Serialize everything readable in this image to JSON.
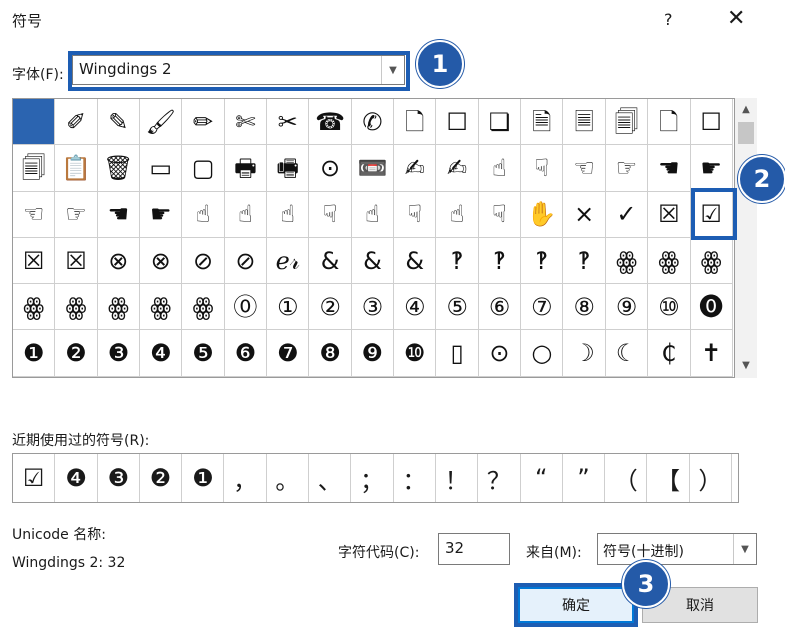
{
  "dialog": {
    "title": "符号",
    "help_label": "?",
    "close_label": "✕"
  },
  "font": {
    "label": "字体(F):",
    "value": "Wingdings 2"
  },
  "symbols": [
    "",
    "✐",
    "✎",
    "🖌",
    "✏",
    "✄",
    "✂",
    "☎",
    "✆",
    "🗋",
    "☐",
    "❏",
    "🗎",
    "🗏",
    "🗐",
    "🗋",
    "☐",
    "🗐",
    "📋",
    "🗑",
    "▭",
    "▢",
    "🖶",
    "🖷",
    "⊙",
    "📼",
    "✍",
    "✍",
    "☝",
    "☟",
    "☜",
    "☞",
    "☚",
    "☛",
    "☜",
    "☞",
    "☚",
    "☛",
    "☝",
    "☝",
    "☝",
    "☟",
    "☝",
    "☟",
    "☝",
    "☟",
    "✋",
    "×",
    "✓",
    "☒",
    "☑",
    "☒",
    "☒",
    "⊗",
    "⊗",
    "⊘",
    "⊘",
    "ℯ𝓇",
    "&",
    "&",
    "&",
    "‽",
    "‽",
    "‽",
    "‽",
    "ꙮ",
    "ꙮ",
    "ꙮ",
    "ꙮ",
    "ꙮ",
    "ꙮ",
    "ꙮ",
    "ꙮ",
    "⓪",
    "①",
    "②",
    "③",
    "④",
    "⑤",
    "⑥",
    "⑦",
    "⑧",
    "⑨",
    "⑩",
    "⓿",
    "❶",
    "❷",
    "❸",
    "❹",
    "❺",
    "❻",
    "❼",
    "❽",
    "❾",
    "❿",
    "▯",
    "⊙",
    "○",
    "☽",
    "☾",
    "₵",
    "✝"
  ],
  "recent": {
    "label": "近期使用过的符号(R):",
    "items": [
      "☑",
      "❹",
      "❸",
      "❷",
      "❶",
      "，",
      "。",
      "、",
      "；",
      "：",
      "！",
      "？",
      "“",
      "”",
      "（",
      "【",
      "）"
    ]
  },
  "unicode": {
    "label": "Unicode 名称:",
    "value": "Wingdings 2: 32"
  },
  "charcode": {
    "label": "字符代码(C):",
    "value": "32"
  },
  "from": {
    "label": "来自(M):",
    "value": "符号(十进制)"
  },
  "buttons": {
    "ok": "确定",
    "cancel": "取消"
  },
  "badges": {
    "one": "1",
    "two": "2",
    "three": "3"
  },
  "colors": {
    "accent": "#245aa8",
    "selection": "#2b64b0"
  }
}
